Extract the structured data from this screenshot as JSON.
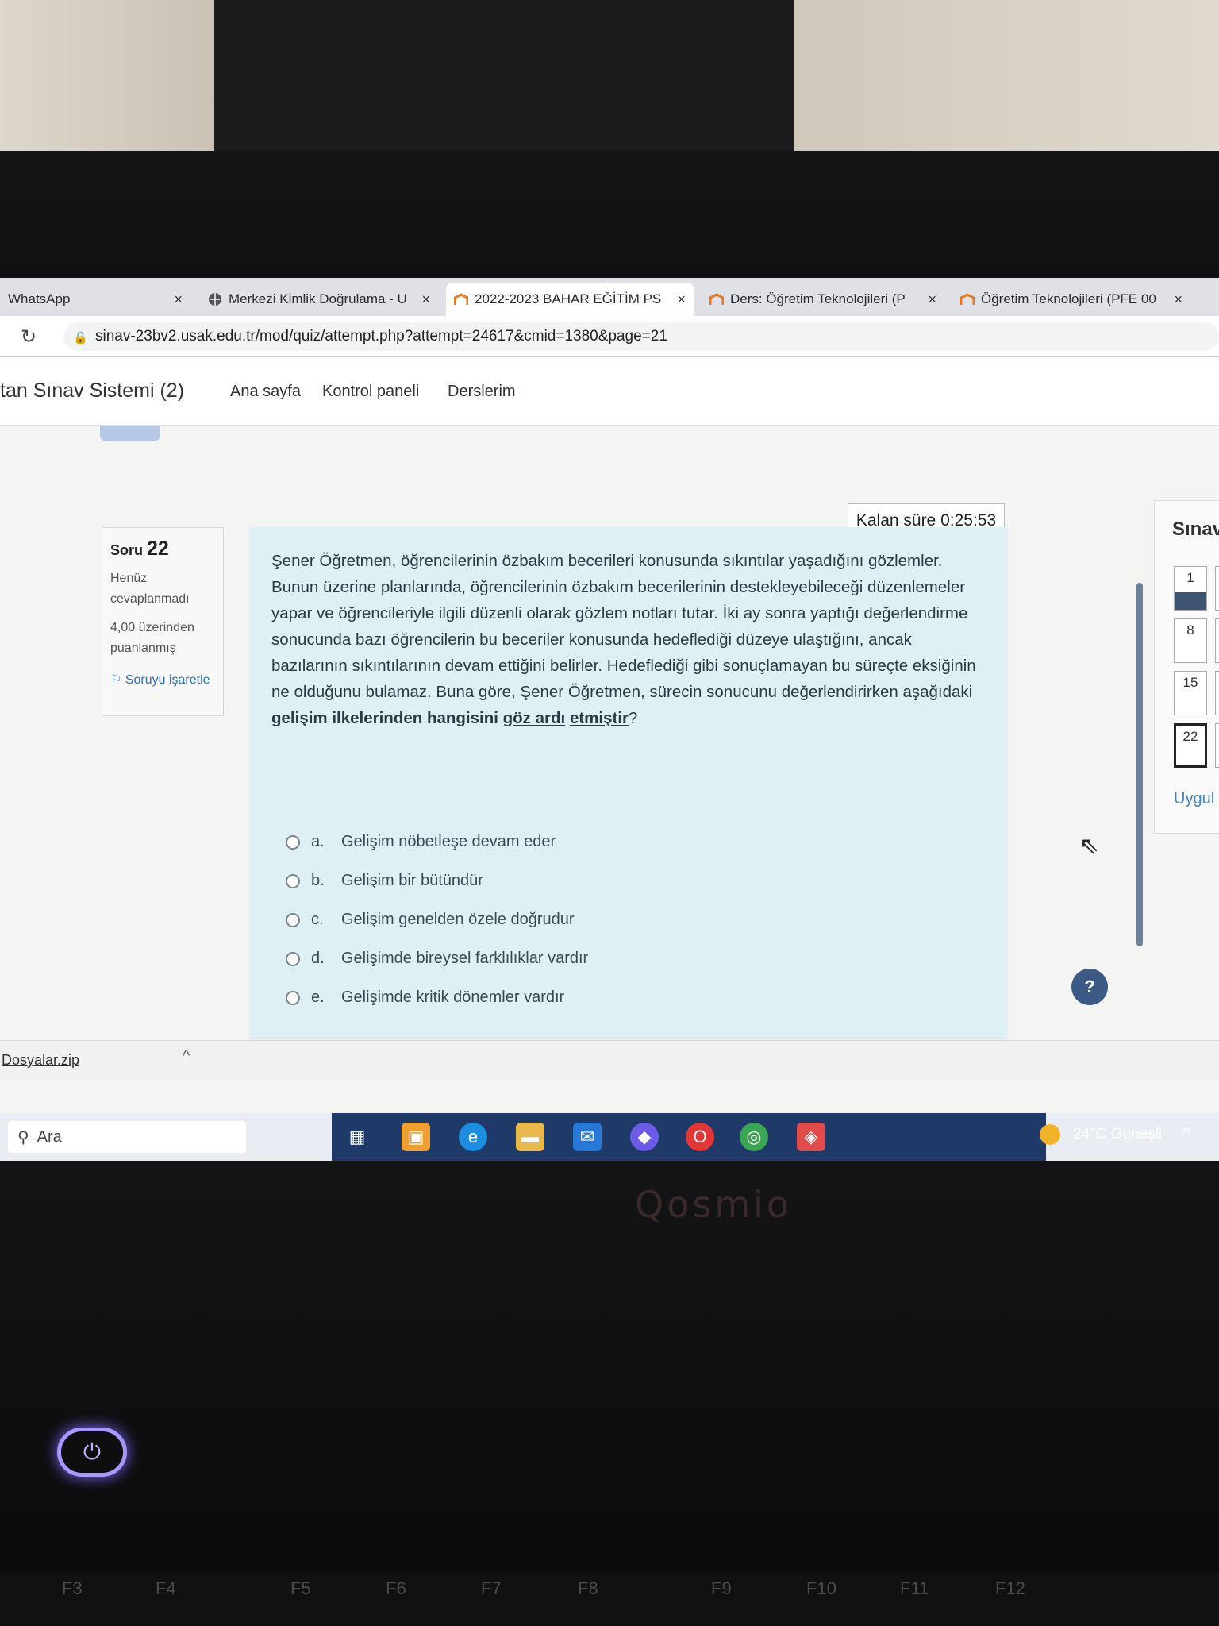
{
  "browser": {
    "tabs": [
      {
        "label": "WhatsApp",
        "active": false
      },
      {
        "label": "Merkezi Kimlik Doğrulama - U",
        "active": false
      },
      {
        "label": "2022-2023 BAHAR EĞİTİM PS",
        "active": true
      },
      {
        "label": "Ders: Öğretim Teknolojileri (P",
        "active": false
      },
      {
        "label": "Öğretim Teknolojileri (PFE 00",
        "active": false
      }
    ],
    "close_glyph": "×",
    "url": "sinav-23bv2.usak.edu.tr/mod/quiz/attempt.php?attempt=24617&cmid=1380&page=21",
    "reload_icon": "reload-icon",
    "lock_icon": "lock-icon"
  },
  "site": {
    "title": "tan Sınav Sistemi (2)",
    "nav": [
      "Ana sayfa",
      "Kontrol paneli",
      "Derslerim"
    ]
  },
  "question_info": {
    "label": "Soru",
    "number": "22",
    "state": "Henüz cevaplanmadı",
    "mark": "4,00 üzerinden puanlanmış",
    "flag_label": "Soruyu işaretle"
  },
  "timer": {
    "text": "Kalan süre 0:25:53"
  },
  "question": {
    "text_plain": "Şener Öğretmen, öğrencilerinin özbakım becerileri konusunda sıkıntılar yaşadığını gözlemler. Bunun üzerine planlarında, öğrencilerinin özbakım becerilerinin destekleyebileceği düzenlemeler yapar ve öğrencileriyle ilgili düzenli olarak gözlem notları tutar. İki ay sonra yaptığı değerlendirme sonucunda bazı öğrencilerin bu beceriler konusunda hedeflediği düzeye ulaştığını, ancak bazılarının sıkıntılarının devam ettiğini belirler. Hedeflediği gibi sonuçlamayan bu süreçte eksiğinin ne olduğunu bulamaz. Buna göre, Şener Öğretmen, sürecin sonucunu değerlendirirken aşağıdaki ",
    "text_bold": "gelişim ilkelerinden hangisini ",
    "text_bold_underline_1": "göz ardı",
    "text_space": " ",
    "text_bold_underline_2": "etmiştir",
    "text_end": "?",
    "answers": [
      {
        "letter": "a.",
        "text": "Gelişim nöbetleşe devam eder"
      },
      {
        "letter": "b.",
        "text": "Gelişim bir bütündür"
      },
      {
        "letter": "c.",
        "text": "Gelişim genelden özele doğrudur"
      },
      {
        "letter": "d.",
        "text": "Gelişimde bireysel farklılıklar vardır"
      },
      {
        "letter": "e.",
        "text": "Gelişimde kritik dönemler vardır"
      }
    ]
  },
  "quiz_nav": {
    "title": "Sınav",
    "buttons": [
      {
        "label": "1",
        "answered": true,
        "current": false
      },
      {
        "label": "8",
        "answered": false,
        "current": false
      },
      {
        "label": "15",
        "answered": false,
        "current": false
      },
      {
        "label": "22",
        "answered": false,
        "current": true
      }
    ],
    "apply_label": "Uygul"
  },
  "help_button": "?",
  "download": {
    "filename": "Dosyalar.zip",
    "chevron": "^"
  },
  "taskbar": {
    "search_label": "Ara",
    "weather": "24°C Güneşli",
    "chevron": "^",
    "icons": [
      "task-view-icon",
      "store-icon",
      "edge-icon",
      "file-explorer-icon",
      "mail-icon",
      "copilot-icon",
      "opera-icon",
      "chrome-icon",
      "app-icon"
    ]
  },
  "device": {
    "brand": "Qosmio",
    "fkeys": [
      "F3",
      "F4",
      "F5",
      "F6",
      "F7",
      "F8",
      "F9",
      "F10",
      "F11",
      "F12"
    ],
    "power_glyph": "⏻"
  },
  "colors": {
    "question_bg": "#dff0f5",
    "accent_blue": "#2f6fb5",
    "taskbar_dark": "#1f3a68",
    "answered_fill": "#3e5470"
  }
}
